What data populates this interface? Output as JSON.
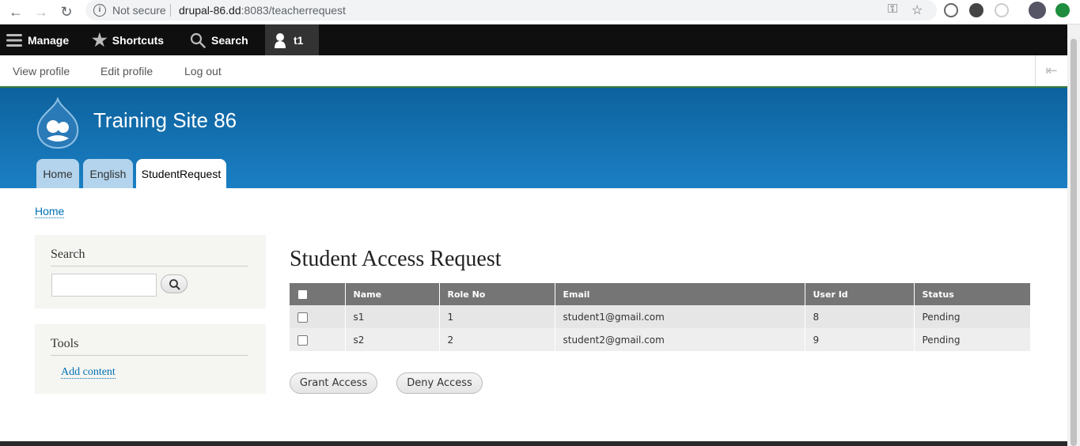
{
  "browser": {
    "security_label": "Not secure",
    "url_host": "drupal-86.dd",
    "url_path": ":8083/teacherrequest",
    "icons": [
      "back-icon",
      "forward-icon",
      "reload-icon",
      "info-icon",
      "key-icon",
      "star-icon"
    ]
  },
  "toolbar": {
    "manage": "Manage",
    "shortcuts": "Shortcuts",
    "search": "Search",
    "user": "t1"
  },
  "tray": {
    "view_profile": "View profile",
    "edit_profile": "Edit profile",
    "log_out": "Log out"
  },
  "header": {
    "site_name": "Training Site 86",
    "tabs": [
      "Home",
      "English",
      "StudentRequest"
    ],
    "active_tab": "StudentRequest"
  },
  "breadcrumb": "Home",
  "sidebar": {
    "search_title": "Search",
    "tools_title": "Tools",
    "tools_link": "Add content"
  },
  "main": {
    "title": "Student Access Request",
    "columns": [
      "Name",
      "Role No",
      "Email",
      "User Id",
      "Status"
    ],
    "rows": [
      {
        "name": "s1",
        "role_no": "1",
        "email": "student1@gmail.com",
        "user_id": "8",
        "status": "Pending"
      },
      {
        "name": "s2",
        "role_no": "2",
        "email": "student2@gmail.com",
        "user_id": "9",
        "status": "Pending"
      }
    ],
    "grant_button": "Grant Access",
    "deny_button": "Deny Access"
  },
  "colors": {
    "header_blue": "#1b7fc4",
    "link": "#0071b3",
    "toolbar": "#0f0f0f"
  }
}
